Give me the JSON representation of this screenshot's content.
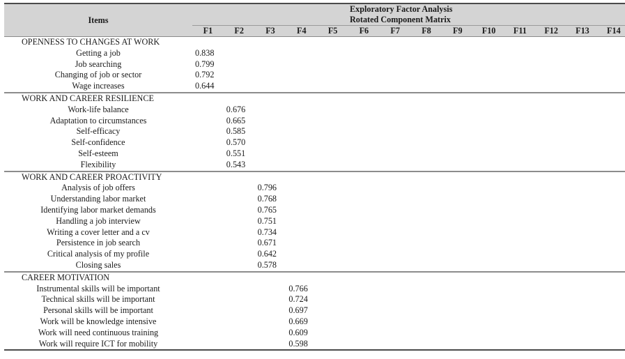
{
  "table": {
    "title_lines": [
      "Exploratory Factor Analysis",
      "Rotated Component Matrix"
    ],
    "items_header": "Items",
    "factors": [
      "F1",
      "F2",
      "F3",
      "F4",
      "F5",
      "F6",
      "F7",
      "F8",
      "F9",
      "F10",
      "F11",
      "F12",
      "F13",
      "F14"
    ],
    "sections": [
      {
        "name": "OPENNESS TO CHANGES AT WORK",
        "factor_index": 0,
        "items": [
          {
            "label": "Getting a job",
            "loading": "0.838"
          },
          {
            "label": "Job searching",
            "loading": "0.799"
          },
          {
            "label": "Changing of job or sector",
            "loading": "0.792"
          },
          {
            "label": "Wage increases",
            "loading": "0.644"
          }
        ]
      },
      {
        "name": "WORK AND CAREER RESILIENCE",
        "factor_index": 1,
        "items": [
          {
            "label": "Work-life balance",
            "loading": "0.676"
          },
          {
            "label": "Adaptation to circumstances",
            "loading": "0.665"
          },
          {
            "label": "Self-efficacy",
            "loading": "0.585"
          },
          {
            "label": "Self-confidence",
            "loading": "0.570"
          },
          {
            "label": "Self-esteem",
            "loading": "0.551"
          },
          {
            "label": "Flexibility",
            "loading": "0.543"
          }
        ]
      },
      {
        "name": "WORK AND CAREER PROACTIVITY",
        "factor_index": 2,
        "items": [
          {
            "label": "Analysis of job offers",
            "loading": "0.796"
          },
          {
            "label": "Understanding labor market",
            "loading": "0.768"
          },
          {
            "label": "Identifying labor market demands",
            "loading": "0.765"
          },
          {
            "label": "Handling a job interview",
            "loading": "0.751"
          },
          {
            "label": "Writing a cover letter and a cv",
            "loading": "0.734"
          },
          {
            "label": "Persistence in job search",
            "loading": "0.671"
          },
          {
            "label": "Critical analysis of my profile",
            "loading": "0.642"
          },
          {
            "label": "Closing sales",
            "loading": "0.578"
          }
        ]
      },
      {
        "name": "CAREER MOTIVATION",
        "factor_index": 3,
        "items": [
          {
            "label": "Instrumental skills will be important",
            "loading": "0.766"
          },
          {
            "label": "Technical skills will be important",
            "loading": "0.724"
          },
          {
            "label": "Personal skills will be important",
            "loading": "0.697"
          },
          {
            "label": "Work will be knowledge intensive",
            "loading": "0.669"
          },
          {
            "label": "Work will need continuous training",
            "loading": "0.609"
          },
          {
            "label": "Work will require ICT for mobility",
            "loading": "0.598"
          }
        ]
      }
    ]
  },
  "colors": {
    "header_bg": "#d4d4d4",
    "rule_dark": "#4a4a4a",
    "rule_light": "#8c8c8c"
  }
}
